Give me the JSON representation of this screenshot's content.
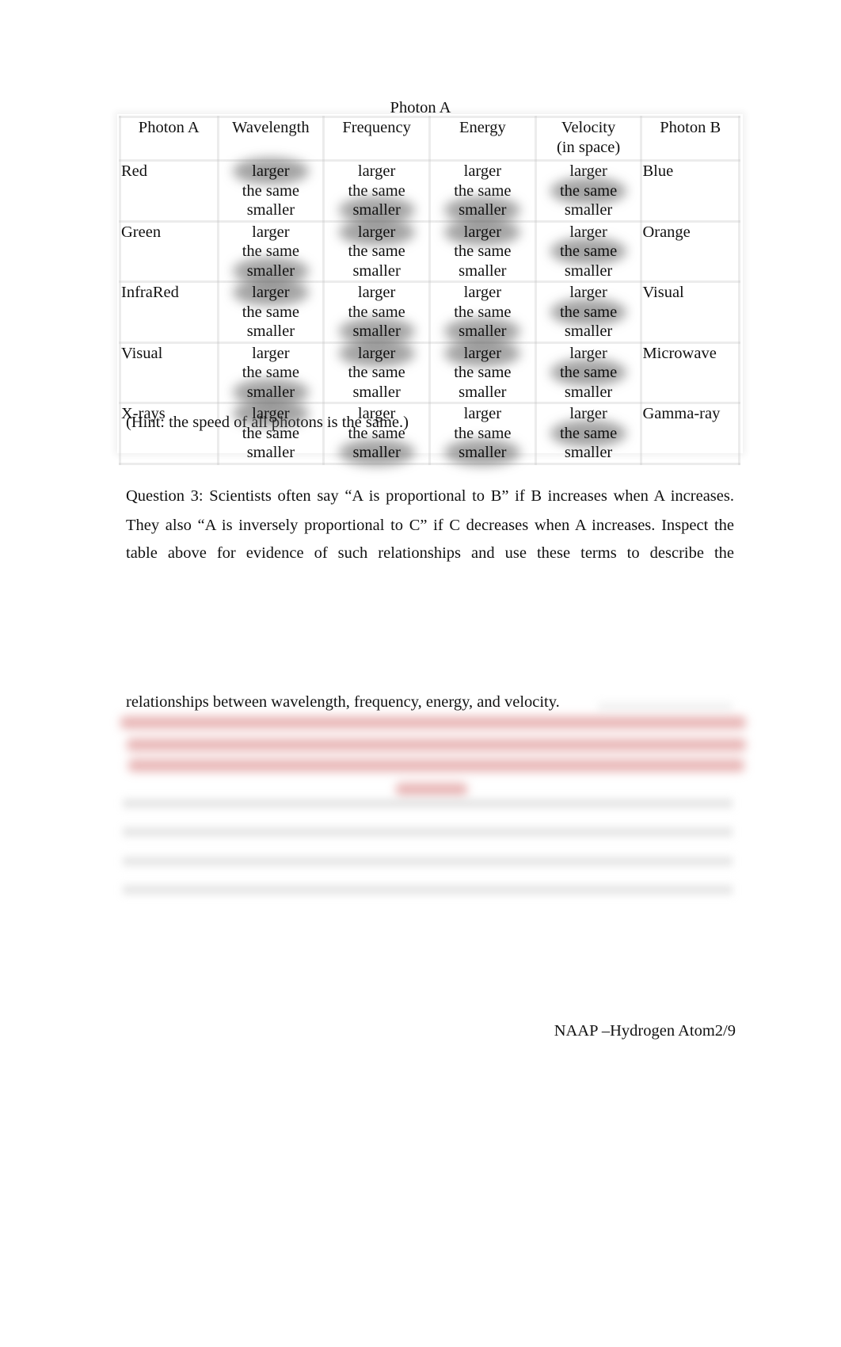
{
  "table": {
    "caption": "Photon A",
    "headers": {
      "photon_a": "Photon A",
      "wavelength": "Wavelength",
      "frequency": "Frequency",
      "energy": "Energy",
      "velocity_line1": "Velocity",
      "velocity_line2": "(in space)",
      "photon_b": "Photon B"
    },
    "choices": [
      "larger",
      "the same",
      "smaller"
    ],
    "rows": [
      {
        "photon_a": "Red",
        "photon_b": "Blue",
        "selected": {
          "wavelength": "larger",
          "frequency": "smaller",
          "energy": "smaller",
          "velocity": "the same"
        }
      },
      {
        "photon_a": "Green",
        "photon_b": "Orange",
        "selected": {
          "wavelength": "smaller",
          "frequency": "larger",
          "energy": "larger",
          "velocity": "the same"
        }
      },
      {
        "photon_a": "InfraRed",
        "photon_b": "Visual",
        "selected": {
          "wavelength": "larger",
          "frequency": "smaller",
          "energy": "smaller",
          "velocity": "the same"
        }
      },
      {
        "photon_a": "Visual",
        "photon_b": "Microwave",
        "selected": {
          "wavelength": "smaller",
          "frequency": "larger",
          "energy": "larger",
          "velocity": "the same"
        }
      },
      {
        "photon_a": "X-rays",
        "photon_b": "Gamma-ray",
        "selected": {
          "wavelength": "larger",
          "frequency": "smaller",
          "energy": "smaller",
          "velocity": "the same"
        }
      }
    ]
  },
  "hint": "(Hint: the speed of all photons is the same.)",
  "question3": {
    "line1": "Question 3: Scientists often say “A is proportional to B” if B increases when A increases.",
    "line2": "They also “A is inversely proportional to C” if C decreases when A increases. Inspect the",
    "line3": "table above for evidence of such relationships and use these terms to describe the",
    "line4": "relationships between wavelength, frequency, energy, and velocity."
  },
  "answer": {
    "state": "blurred / unreadable",
    "text_color": "#d67878"
  },
  "footer": {
    "text": "NAAP –Hydrogen Atom2/9"
  }
}
